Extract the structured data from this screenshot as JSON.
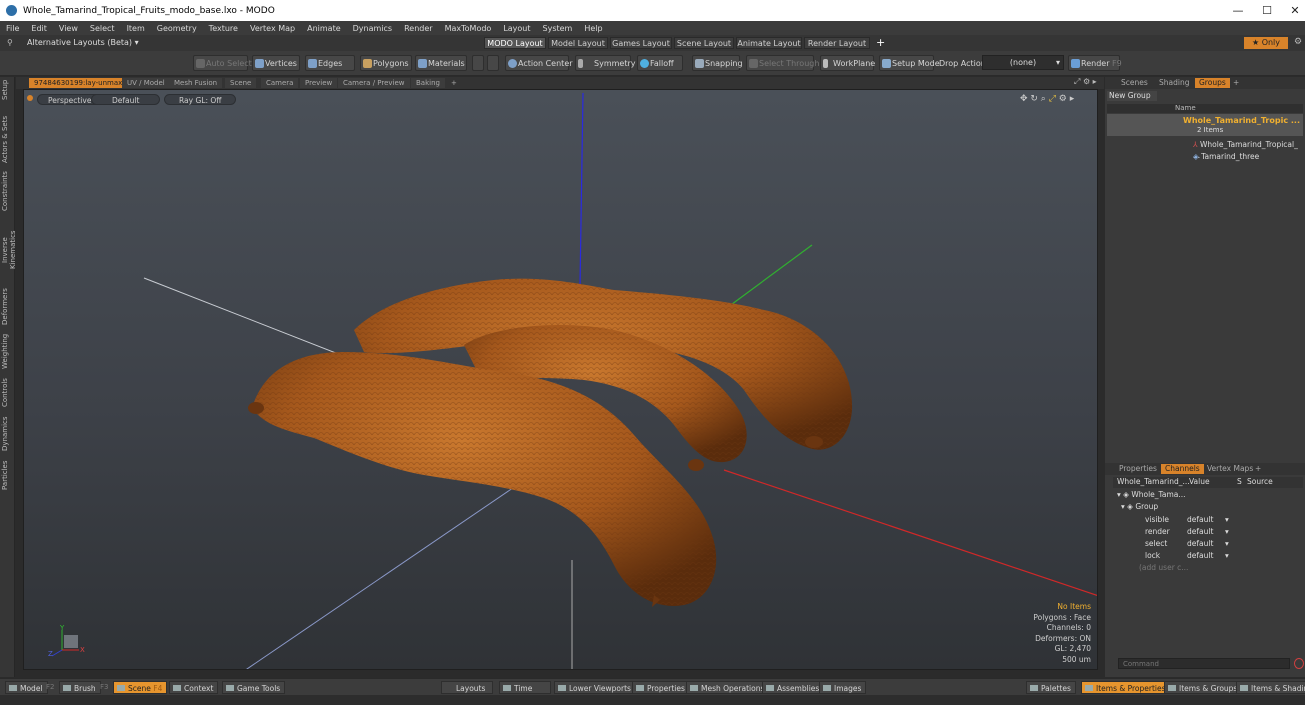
{
  "window": {
    "title": "Whole_Tamarind_Tropical_Fruits_modo_base.lxo - MODO",
    "minimize": "—",
    "maximize": "☐",
    "close": "✕"
  },
  "menu": [
    "File",
    "Edit",
    "View",
    "Select",
    "Item",
    "Geometry",
    "Texture",
    "Vertex Map",
    "Animate",
    "Dynamics",
    "Render",
    "MaxToModo",
    "Layout",
    "System",
    "Help"
  ],
  "layouts": {
    "alt_label": "Alternative Layouts (Beta)",
    "tabs": [
      "MODO Layout",
      "Model Layout",
      "Games Layout",
      "Scene Layout",
      "Animate Layout",
      "Render Layout"
    ],
    "active": "MODO Layout",
    "only_label": "Only"
  },
  "toolbar": {
    "auto_select": "Auto Select",
    "vertices": "Vertices",
    "edges": "Edges",
    "polygons": "Polygons",
    "materials": "Materials",
    "action_center": "Action Center",
    "symmetry": "Symmetry",
    "falloff": "Falloff",
    "snapping": "Snapping",
    "select_through": "Select Through",
    "workplane": "WorkPlane",
    "setup_mode": "Setup Mode",
    "drop_action": "Drop Action",
    "drop_value": "(none)",
    "render": "Render",
    "render_key": "F9"
  },
  "left_tabs": [
    "Setup",
    "Actors & Sets",
    "Constraints",
    "Inverse Kinematics",
    "Deformers",
    "Weighting",
    "Controls",
    "Dynamics",
    "Particles"
  ],
  "viewport_tabs": [
    "97484630199:lay-unmax",
    "UV / Model",
    "Mesh Fusion",
    "Scene",
    "Camera",
    "Preview",
    "Camera / Preview",
    "Baking",
    "+"
  ],
  "viewport": {
    "perspective": "Perspective",
    "shading": "Default",
    "raygl": "Ray GL: Off",
    "info": {
      "items": "No Items",
      "polygons": "Polygons : Face",
      "channels": "Channels: 0",
      "deformers": "Deformers: ON",
      "gl": "GL: 2,470",
      "scale": "500 um"
    },
    "axis_y": "Y",
    "axis_z": "Z",
    "axis_x": "X"
  },
  "groups_panel": {
    "tabs": [
      "Scenes",
      "Shading",
      "Groups",
      "+"
    ],
    "active": "Groups",
    "new_group": "New Group",
    "name_header": "Name",
    "group_name": "Whole_Tamarind_Tropic ...",
    "group_count": "2 Items",
    "children": [
      "Whole_Tamarind_Tropical_ ...",
      "Tamarind_three"
    ]
  },
  "channels_panel": {
    "tabs": [
      "Properties",
      "Channels",
      "Vertex Maps",
      "+"
    ],
    "active": "Channels",
    "headers": [
      "Whole_Tamarind_...",
      "Value",
      "S",
      "Source"
    ],
    "root": "Whole_Tama...",
    "group": "Group",
    "rows": [
      {
        "name": "visible",
        "value": "default"
      },
      {
        "name": "render",
        "value": "default"
      },
      {
        "name": "select",
        "value": "default"
      },
      {
        "name": "lock",
        "value": "default"
      }
    ],
    "add_user": "(add user c...",
    "command_placeholder": "Command"
  },
  "statusbar": {
    "model": "Model",
    "model_key": "F2",
    "brush": "Brush",
    "brush_key": "F3",
    "scene": "Scene",
    "scene_key": "F4",
    "context": "Context",
    "game_tools": "Game Tools",
    "layouts": "Layouts",
    "time": "Time",
    "lower_viewports": "Lower Viewports",
    "properties": "Properties",
    "mesh_operations": "Mesh Operations",
    "assemblies": "Assemblies",
    "images": "Images",
    "palettes": "Palettes",
    "items_properties": "Items & Properties",
    "items_groups": "Items & Groups",
    "items_shading": "Items & Shading"
  },
  "colors": {
    "accent": "#e6952e",
    "axis_x": "#d03030",
    "axis_y": "#30a030",
    "axis_z": "#3040d0"
  }
}
